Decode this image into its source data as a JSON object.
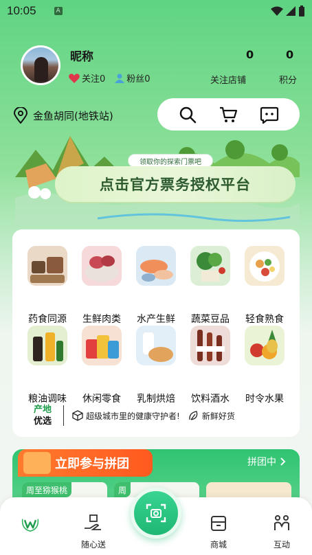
{
  "status_bar": {
    "time": "10:05",
    "a_icon": "A"
  },
  "profile": {
    "nickname": "昵称",
    "follow_label": "关注0",
    "fans_label": "粉丝0",
    "stats": [
      {
        "value": "0",
        "label": "关注店铺"
      },
      {
        "value": "0",
        "label": "积分"
      }
    ]
  },
  "location": {
    "text": "金鱼胡同(地铁站)"
  },
  "actions": {
    "icons": [
      "search-icon",
      "cart-icon",
      "message-icon"
    ]
  },
  "banner": {
    "pill_text": "领取你的探索门票吧",
    "title": "点击官方票务授权平台"
  },
  "categories": [
    {
      "label": "药食同源",
      "color": "#e9d9c6"
    },
    {
      "label": "生鲜肉类",
      "color": "#f6dada"
    },
    {
      "label": "水产生鲜",
      "color": "#dbe9f5"
    },
    {
      "label": "蔬菜豆品",
      "color": "#dcefd6"
    },
    {
      "label": "轻食熟食",
      "color": "#f6ead3"
    },
    {
      "label": "粮油调味",
      "color": "#e3efd0"
    },
    {
      "label": "休闲零食",
      "color": "#f6e1d3"
    },
    {
      "label": "乳制烘焙",
      "color": "#e2eef8"
    },
    {
      "label": "饮料酒水",
      "color": "#eedcd8"
    },
    {
      "label": "时令水果",
      "color": "#eaf3d6"
    }
  ],
  "origin": {
    "logo_line1": "产地",
    "logo_line2": "优选",
    "tag1": "超级城市里的健康守护者!",
    "tag2": "新鲜好货"
  },
  "group_buy": {
    "title": "立即参与拼团",
    "status": "拼团中",
    "items": [
      "周至猕猴桃",
      "周",
      ""
    ]
  },
  "nav": {
    "items": [
      {
        "label": ""
      },
      {
        "label": "随心送"
      },
      {
        "label": "商城"
      },
      {
        "label": "互动"
      }
    ]
  },
  "colors": {
    "brand_green": "#1fb774",
    "orange": "#ff5a1f",
    "heart": "#e0364b",
    "fans": "#4aa3d6"
  }
}
